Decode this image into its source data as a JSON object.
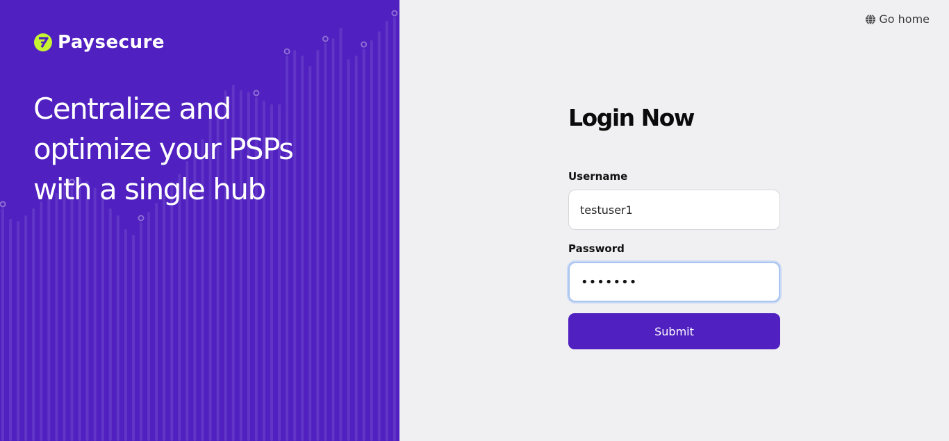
{
  "brand": {
    "name": "Paysecure",
    "logo_icon": "paysecure-logo-icon",
    "accent_color": "#C6F432"
  },
  "hero": {
    "headline": "Centralize and optimize your PSPs with a single hub",
    "background_color": "#5020C0"
  },
  "nav": {
    "go_home_label": "Go home",
    "go_home_icon": "globe-icon"
  },
  "login": {
    "title": "Login Now",
    "username_label": "Username",
    "username_value": "testuser1",
    "password_label": "Password",
    "password_value": "•••••••",
    "submit_label": "Submit",
    "button_color": "#5020C0"
  }
}
